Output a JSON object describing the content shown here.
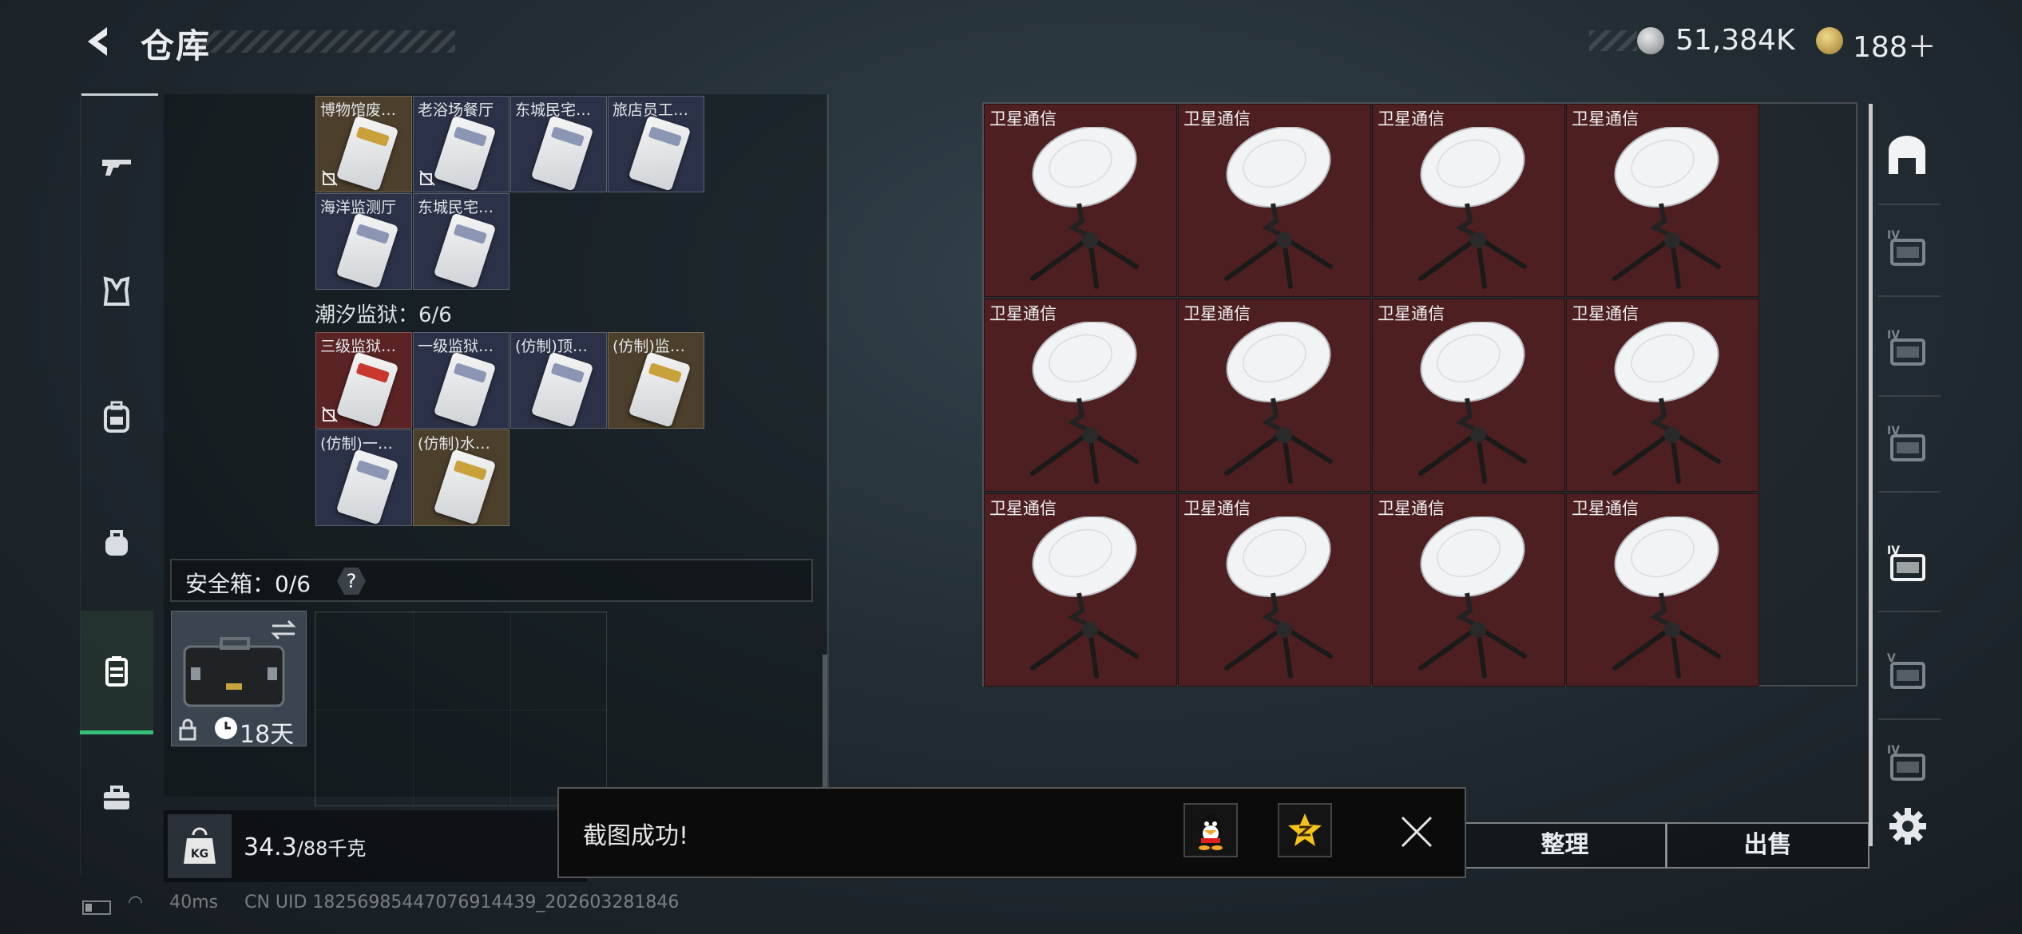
{
  "header": {
    "title": "仓库",
    "currency_silver": "51,384K",
    "currency_gold": "188＋"
  },
  "left_nav": {
    "items": [
      "rifle-icon",
      "armor-icon",
      "backpack-icon",
      "bag-icon",
      "safe-case-icon",
      "toolbox-icon"
    ],
    "active_index": 4
  },
  "collections": {
    "row1": [
      {
        "label": "博物馆废…",
        "color": "brown",
        "unlinked": true
      },
      {
        "label": "老浴场餐厅",
        "color": "navy",
        "unlinked": true
      },
      {
        "label": "东城民宅…",
        "color": "navy",
        "unlinked": false
      },
      {
        "label": "旅店员工…",
        "color": "navy",
        "unlinked": false
      }
    ],
    "row2": [
      {
        "label": "海洋监测厅",
        "color": "navy",
        "unlinked": false
      },
      {
        "label": "东城民宅…",
        "color": "navy",
        "unlinked": false
      }
    ],
    "prison_label": "潮汐监狱：6/6",
    "row3": [
      {
        "label": "三级监狱…",
        "color": "red",
        "unlinked": true
      },
      {
        "label": "一级监狱…",
        "color": "navy",
        "unlinked": false
      },
      {
        "label": "(仿制)顶…",
        "color": "navy",
        "unlinked": false
      },
      {
        "label": "(仿制)监…",
        "color": "brown",
        "unlinked": false
      }
    ],
    "row4": [
      {
        "label": "(仿制)一…",
        "color": "navy",
        "unlinked": false
      },
      {
        "label": "(仿制)水…",
        "color": "brown",
        "unlinked": false
      }
    ]
  },
  "safe_box": {
    "label": "安全箱：0/6",
    "help": "?",
    "timer": "18天"
  },
  "weight": {
    "value": "34.3",
    "unit": "/88千克",
    "icon_text": "KG"
  },
  "stash": {
    "item_name": "卫星通信",
    "rows": [
      [
        "卫星通信",
        "卫星通信",
        "卫星通信",
        "卫星通信"
      ],
      [
        "卫星通信",
        "卫星通信",
        "卫星通信",
        "卫星通信"
      ],
      [
        "卫星通信",
        "卫星通信",
        "卫星通信",
        "卫星通信"
      ]
    ]
  },
  "right_nav": {
    "items": [
      "home-stash-icon",
      "rack-iv-icon",
      "shelf-iv-icon",
      "box-add-iv-icon",
      "case-iv-icon",
      "case-v-icon",
      "case-iv-small-icon"
    ],
    "levels": [
      "",
      "IV",
      "IV",
      "IV",
      "IV",
      "V",
      "IV"
    ]
  },
  "buttons": {
    "sort": "整理",
    "sell": "出售"
  },
  "toast": {
    "message": "截图成功!",
    "qq_icon": "qq-icon",
    "qzone_icon": "qzone-icon"
  },
  "status_bar": {
    "ping": "40ms",
    "uid": "CN UID 18256985447076914439_202603281846"
  },
  "colors": {
    "stash_cell": "#4e1f20",
    "active_nav": "#35c07a",
    "gold": "#d1a73e"
  }
}
